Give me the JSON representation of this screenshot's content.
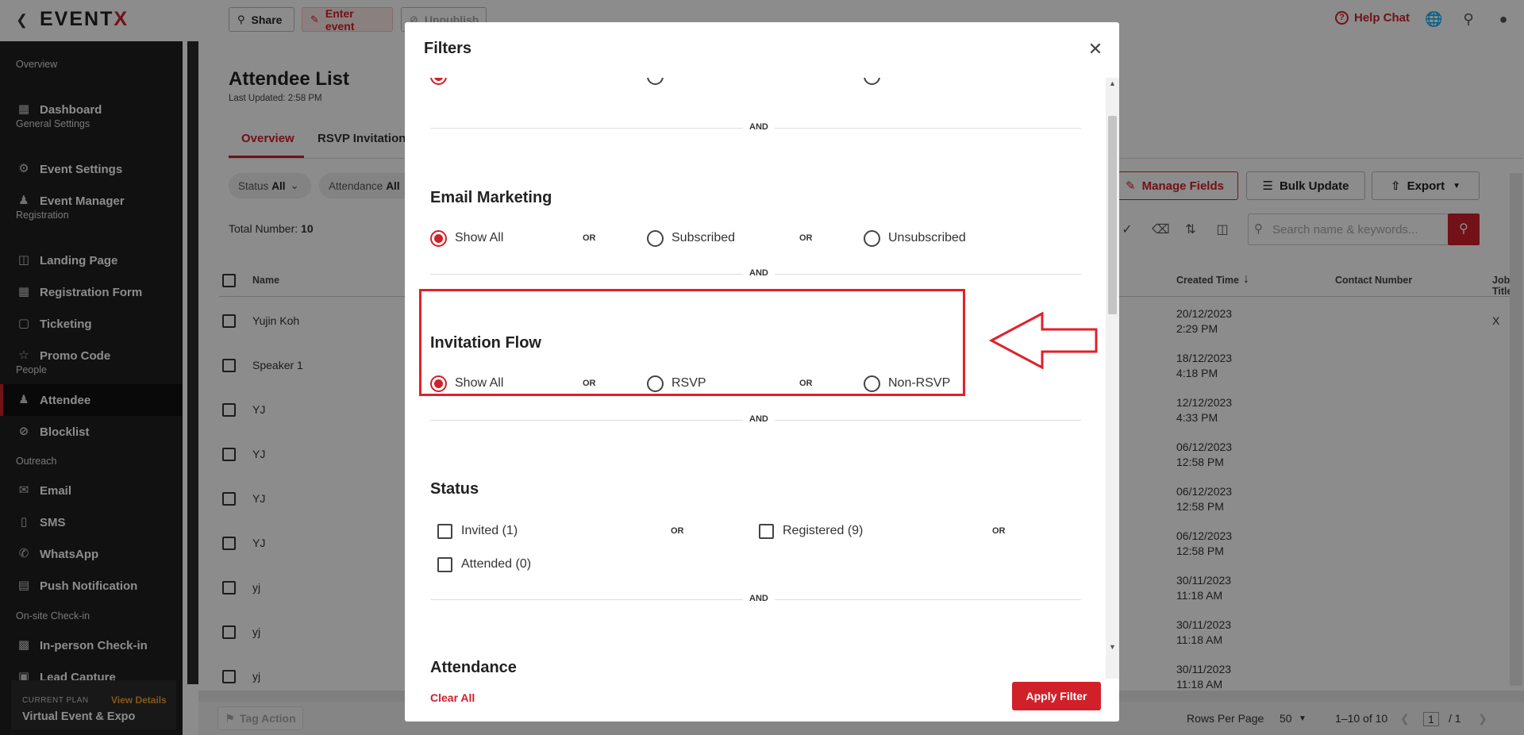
{
  "topbar": {
    "logo": "EVENTX",
    "share": "Share",
    "enter_event": "Enter event",
    "unpublish": "Unpublish",
    "help_chat": "Help Chat"
  },
  "sidebar": {
    "sections": [
      {
        "label": "Overview",
        "items": [
          {
            "label": "Dashboard",
            "icon": "dashboard-icon"
          }
        ]
      },
      {
        "label": "General Settings",
        "items": [
          {
            "label": "Event Settings",
            "icon": "settings-icon"
          },
          {
            "label": "Event Manager",
            "icon": "users-icon"
          }
        ]
      },
      {
        "label": "Registration",
        "items": [
          {
            "label": "Landing Page",
            "icon": "grid-icon"
          },
          {
            "label": "Registration Form",
            "icon": "table-icon"
          },
          {
            "label": "Ticketing",
            "icon": "ticket-icon"
          },
          {
            "label": "Promo Code",
            "icon": "star-icon"
          }
        ]
      },
      {
        "label": "People",
        "items": [
          {
            "label": "Attendee",
            "icon": "attendee-icon"
          },
          {
            "label": "Blocklist",
            "icon": "block-icon"
          }
        ]
      },
      {
        "label": "Outreach",
        "items": [
          {
            "label": "Email",
            "icon": "mail-icon"
          },
          {
            "label": "SMS",
            "icon": "phone-icon"
          },
          {
            "label": "WhatsApp",
            "icon": "whatsapp-icon"
          },
          {
            "label": "Push Notification",
            "icon": "notification-icon"
          }
        ]
      },
      {
        "label": "On-site Check-in",
        "items": [
          {
            "label": "In-person Check-in",
            "icon": "qr-icon"
          },
          {
            "label": "Lead Capture",
            "icon": "capture-icon"
          }
        ]
      }
    ],
    "plan_label": "CURRENT PLAN",
    "plan_link": "View Details",
    "plan_name": "Virtual Event & Expo"
  },
  "page": {
    "title": "Attendee List",
    "last_updated": "Last Updated: 2:58 PM",
    "tabs": [
      "Overview",
      "RSVP Invitation"
    ],
    "filter_status_label": "Status",
    "filter_status_value": "All",
    "filter_attendance_label": "Attendance",
    "filter_attendance_value": "All",
    "total_label": "Total Number:",
    "total_value": "10",
    "manage_fields": "Manage Fields",
    "bulk_update": "Bulk Update",
    "export": "Export",
    "search_placeholder": "Search name & keywords...",
    "columns": {
      "name": "Name",
      "created_time": "Created Time",
      "contact_number": "Contact Number",
      "job_title": "Job Title"
    },
    "rows": [
      {
        "name": "Yujin Koh",
        "date": "20/12/2023",
        "time": "2:29 PM",
        "job": "X"
      },
      {
        "name": "Speaker 1",
        "date": "18/12/2023",
        "time": "4:18 PM",
        "job": ""
      },
      {
        "name": "YJ",
        "date": "12/12/2023",
        "time": "4:33 PM",
        "job": ""
      },
      {
        "name": "YJ",
        "date": "06/12/2023",
        "time": "12:58 PM",
        "job": ""
      },
      {
        "name": "YJ",
        "date": "06/12/2023",
        "time": "12:58 PM",
        "job": ""
      },
      {
        "name": "YJ",
        "date": "06/12/2023",
        "time": "12:58 PM",
        "job": ""
      },
      {
        "name": "yj",
        "date": "30/11/2023",
        "time": "11:18 AM",
        "job": ""
      },
      {
        "name": "yj",
        "date": "30/11/2023",
        "time": "11:18 AM",
        "job": ""
      },
      {
        "name": "yj",
        "date": "30/11/2023",
        "time": "11:18 AM",
        "job": ""
      }
    ],
    "footer": {
      "tag_action": "Tag Action",
      "rows_per_page_label": "Rows Per Page",
      "rows_per_page_value": "50",
      "range": "1–10 of 10",
      "page_current": "1",
      "page_total": "/ 1"
    }
  },
  "modal": {
    "title": "Filters",
    "and": "AND",
    "or": "OR",
    "email_marketing": {
      "title": "Email Marketing",
      "options": [
        "Show All",
        "Subscribed",
        "Unsubscribed"
      ],
      "selected": "Show All"
    },
    "invitation_flow": {
      "title": "Invitation Flow",
      "options": [
        "Show All",
        "RSVP",
        "Non-RSVP"
      ],
      "selected": "Show All"
    },
    "status": {
      "title": "Status",
      "options": [
        "Invited (1)",
        "Registered (9)",
        "Attended (0)"
      ]
    },
    "attendance": {
      "title": "Attendance"
    },
    "clear_all": "Clear All",
    "apply": "Apply Filter"
  },
  "colors": {
    "accent": "#d0202a",
    "sidebar_bg": "#1f1f1f"
  }
}
